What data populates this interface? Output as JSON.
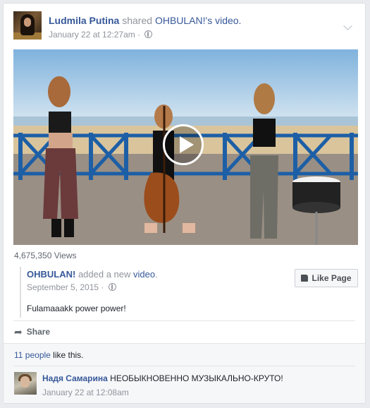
{
  "post": {
    "author": "Ludmila Putina",
    "shared_text": "shared",
    "shared_source": "OHBULAN!",
    "shared_suffix": "'s video.",
    "timestamp": "January 22 at 12:27am",
    "separator": "·",
    "views": "4,675,350 Views"
  },
  "shared_post": {
    "page_name": "OHBULAN!",
    "action_text": "added a new",
    "action_link": "video",
    "action_end": ".",
    "date": "September 5, 2015",
    "separator": "·",
    "text": "Fulamaaakk power power!",
    "like_page_label": "Like Page"
  },
  "actions": {
    "share_label": "Share"
  },
  "ufi": {
    "likes_count_link": "11 people",
    "likes_suffix": "like this."
  },
  "comment": {
    "author": "Надя Самарина",
    "text": "НЕОБЫКНОВЕННО МУЗЫКАЛЬНО-КРУТО!",
    "time": "January 22 at 12:08am"
  },
  "icons": {
    "privacy": "globe-icon",
    "menu": "chevron-down-icon",
    "play": "play-icon",
    "like": "thumbs-up-icon",
    "share": "share-arrow-icon"
  },
  "colors": {
    "link": "#365899",
    "meta": "#90949c",
    "background": "#e9ebee"
  }
}
